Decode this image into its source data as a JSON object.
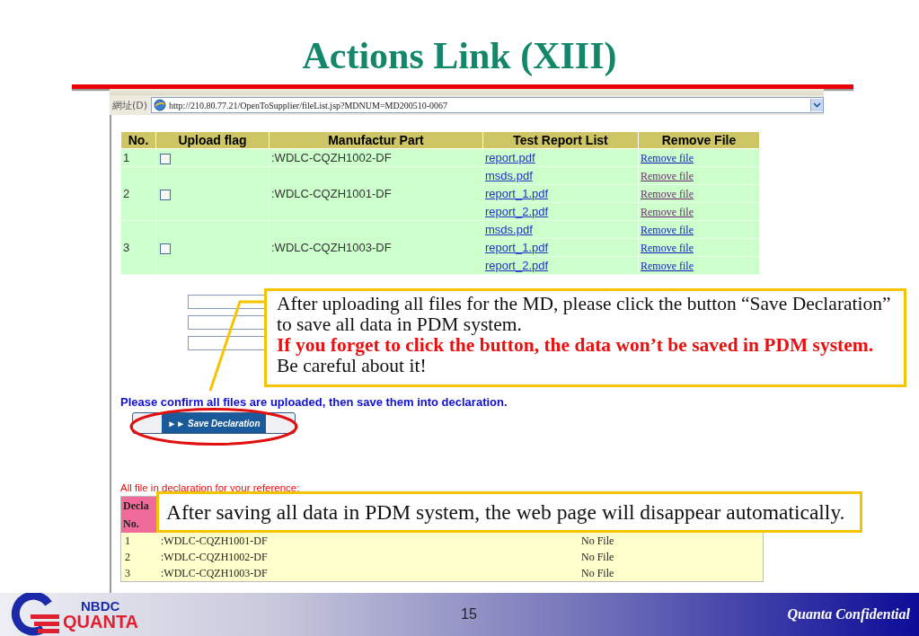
{
  "slide": {
    "title": "Actions Link (XIII)",
    "page_number": "15",
    "confidential": "Quanta Confidential",
    "logo": {
      "line_1": "NBDC",
      "line_2": "QUANTA"
    }
  },
  "browser": {
    "address_label": "網址(D)",
    "url": "http://210.80.77.21/OpenToSupplier/fileList.jsp?MDNUM=MD200510-0067"
  },
  "file_table": {
    "columns": [
      "No.",
      "Upload flag",
      "Manufactur Part",
      "Test Report List",
      "Remove File"
    ],
    "rows": [
      {
        "no": "1",
        "checked": false,
        "part": ":WDLC-CQZH1002-DF",
        "files": [
          {
            "name": "report.pdf",
            "remove": "Remove file",
            "visited": false
          }
        ]
      },
      {
        "no": "2",
        "checked": false,
        "part": ":WDLC-CQZH1001-DF",
        "files": [
          {
            "name": "msds.pdf",
            "remove": "Remove file",
            "visited": true
          },
          {
            "name": "report_1.pdf",
            "remove": "Remove file",
            "visited": true
          },
          {
            "name": "report_2.pdf",
            "remove": "Remove file",
            "visited": true
          }
        ]
      },
      {
        "no": "3",
        "checked": false,
        "part": ":WDLC-CQZH1003-DF",
        "files": [
          {
            "name": "msds.pdf",
            "remove": "Remove file",
            "visited": false
          },
          {
            "name": "report_1.pdf",
            "remove": "Remove file",
            "visited": false
          },
          {
            "name": "report_2.pdf",
            "remove": "Remove file",
            "visited": false
          }
        ]
      }
    ]
  },
  "confirm_text": "Please confirm all files are uploaded, then save them into declaration.",
  "save_button": {
    "label": "►► Save Declaration"
  },
  "reference_title": "All file in declaration for your reference:",
  "declaration_table": {
    "header_1": "Decla",
    "header_2": "No.",
    "rows": [
      {
        "no": "1",
        "part": ":WDLC-CQZH1001-DF",
        "file": "No File"
      },
      {
        "no": "2",
        "part": ":WDLC-CQZH1002-DF",
        "file": "No File"
      },
      {
        "no": "3",
        "part": ":WDLC-CQZH1003-DF",
        "file": "No File"
      }
    ]
  },
  "callouts": [
    {
      "kind": "save",
      "text": "After uploading all files for the MD, please click the button “Save Declaration” to save all data in PDM system.",
      "warning": "If you forget to click the button, the data won’t be saved in PDM system.",
      "note": "Be careful about it!"
    },
    {
      "kind": "disappear",
      "text": "After saving all data in PDM system, the web page will disappear automatically."
    }
  ]
}
